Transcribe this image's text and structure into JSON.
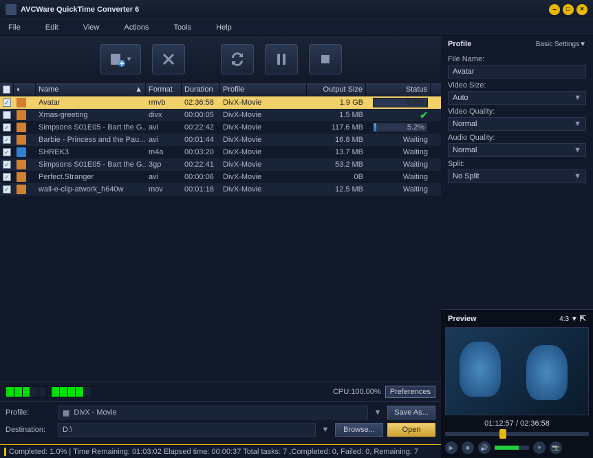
{
  "title": "AVCWare QuickTime Converter 6",
  "menu": [
    "File",
    "Edit",
    "View",
    "Actions",
    "Tools",
    "Help"
  ],
  "columns": {
    "name": "Name",
    "format": "Format",
    "duration": "Duration",
    "profile": "Profile",
    "output": "Output Size",
    "status": "Status"
  },
  "rows": [
    {
      "chk": true,
      "ico": "orange",
      "name": "Avatar",
      "fmt": "rmvb",
      "dur": "02:36:58",
      "prof": "DivX-Movie",
      "out": "1.9 GB",
      "stat": "0.6%",
      "progress": 0.6,
      "sel": true
    },
    {
      "chk": false,
      "ico": "orange",
      "name": "Xmas-greeting",
      "fmt": "divx",
      "dur": "00:00:05",
      "prof": "DivX-Movie",
      "out": "1.5 MB",
      "stat": "done"
    },
    {
      "chk": true,
      "ico": "orange",
      "name": "Simpsons S01E05 - Bart the G...",
      "fmt": "avi",
      "dur": "00:22:42",
      "prof": "DivX-Movie",
      "out": "117.6 MB",
      "stat": "5.2%",
      "progress": 5.2
    },
    {
      "chk": true,
      "ico": "orange",
      "name": "Barbie - Princess and the Pau...",
      "fmt": "avi",
      "dur": "00:01:44",
      "prof": "DivX-Movie",
      "out": "16.8 MB",
      "stat": "Waiting"
    },
    {
      "chk": true,
      "ico": "blue",
      "name": "SHREK3",
      "fmt": "m4a",
      "dur": "00:03:20",
      "prof": "DivX-Movie",
      "out": "13.7 MB",
      "stat": "Waiting"
    },
    {
      "chk": true,
      "ico": "orange",
      "name": "Simpsons S01E05 - Bart the G...",
      "fmt": "3gp",
      "dur": "00:22:41",
      "prof": "DivX-Movie",
      "out": "53.2 MB",
      "stat": "Waiting"
    },
    {
      "chk": true,
      "ico": "orange",
      "name": "Perfect.Stranger",
      "fmt": "avi",
      "dur": "00:00:06",
      "prof": "DivX-Movie",
      "out": "0B",
      "stat": "Waiting"
    },
    {
      "chk": true,
      "ico": "orange",
      "name": "wall-e-clip-atwork_h640w",
      "fmt": "mov",
      "dur": "00:01:18",
      "prof": "DivX-Movie",
      "out": "12.5 MB",
      "stat": "Waiting"
    }
  ],
  "cpu": {
    "label": "CPU:100.00%",
    "prefs": "Preferences"
  },
  "bottom": {
    "profileLabel": "Profile:",
    "profileValue": "DivX - Movie",
    "destLabel": "Destination:",
    "destValue": "D:\\",
    "saveAs": "Save As...",
    "browse": "Browse...",
    "open": "Open"
  },
  "status": "Completed: 1.0% | Time Remaining: 01:03:02 Elapsed time: 00:00:37 Total tasks: 7 ,Completed: 0, Failed: 0, Remaining: 7",
  "profile": {
    "title": "Profile",
    "basic": "Basic Settings▼",
    "fileNameLabel": "File Name:",
    "fileName": "Avatar",
    "videoSizeLabel": "Video Size:",
    "videoSize": "Auto",
    "videoQualityLabel": "Video Quality:",
    "videoQuality": "Normal",
    "audioQualityLabel": "Audio Quality:",
    "audioQuality": "Normal",
    "splitLabel": "Split:",
    "split": "No Split"
  },
  "preview": {
    "title": "Preview",
    "ratio": "4:3 ▼",
    "time": "01:12:57 / 02:36:58"
  }
}
